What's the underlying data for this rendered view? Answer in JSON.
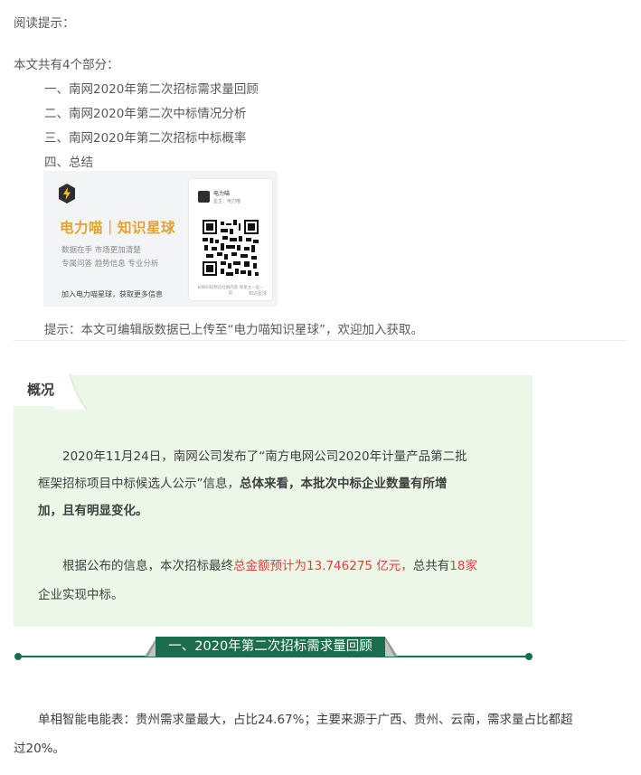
{
  "reading_tip": "阅读提示：",
  "outline": {
    "intro": "本文共有4个部分：",
    "items": [
      "一、南网2020年第二次招标需求量回顾",
      "二、南网2020年第二次中标情况分析",
      "三、南网2020年第二次招标中标概率",
      "四、总结"
    ]
  },
  "banner": {
    "brand": "电力喵｜知识星球",
    "taglines": [
      "数据在手  市场更加清楚",
      "专属问答  趋势信息  专业分析"
    ],
    "join": "加入电力喵星球，获取更多信息",
    "card_name": "电力喵",
    "card_owner": "星主：电力喵",
    "card_hint": "长按扫码预览社群内容 和星主一起一起",
    "card_mark": "知识星球",
    "icon": "lightning-bolt-icon"
  },
  "note": "提示：本文可编辑版数据已上传至“电力喵知识星球”，欢迎加入获取。",
  "overview": {
    "tab": "概况",
    "p1_l1": "2020年11月24日，南网公司发布了“南方电网公司2020年计量产品第二批",
    "p1_l2a": "框架招标项目中标候选人公示”信息，",
    "p1_l2b": "总体来看，本批次中标企业数量有所增",
    "p1_l3": "加，且有明显变化。",
    "p2_a": "根据公布的信息，本次招标最终",
    "p2_b": "总金额预计为13.746275 亿元，",
    "p2_c": "总共有",
    "p2_d": "18家",
    "p2_l2": "企业实现中标。"
  },
  "section1": {
    "title": "一、2020年第二次招标需求量回顾"
  },
  "body": {
    "l1": "单相智能电能表：贵州需求量最大，占比24.67%；主要来源于广西、贵州、云南，需求量占比都超",
    "l2": "过20%。"
  },
  "colors": {
    "text": "#595959",
    "accent_green": "#1b6d4b",
    "box_bg": "#ebf8e8",
    "highlight_red": "#e0403a",
    "brand_orange": "#e6a22b"
  }
}
